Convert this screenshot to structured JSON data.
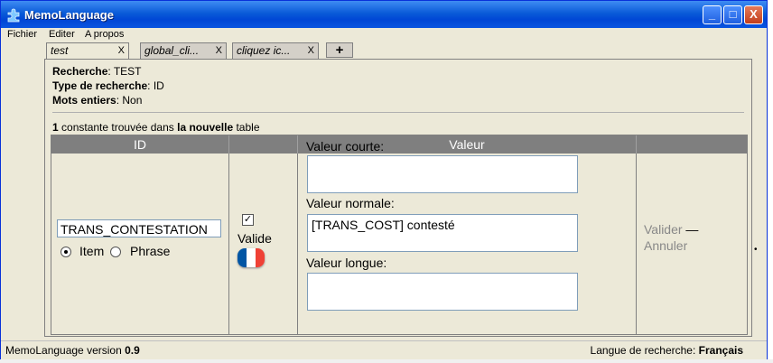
{
  "window": {
    "title": "MemoLanguage",
    "minimize": "_",
    "maximize": "□",
    "close": "X"
  },
  "menu": [
    "Fichier",
    "Editer",
    "A propos"
  ],
  "tabs": [
    {
      "label": "test",
      "close": "X"
    },
    {
      "label": "global_cli...",
      "close": "X"
    },
    {
      "label": "cliquez ic...",
      "close": "X"
    }
  ],
  "add_tab": "+",
  "search_info": {
    "recherche_label": "Recherche",
    "recherche_value": ": TEST",
    "type_label": "Type de recherche",
    "type_value": ": ID",
    "mots_label": "Mots entiers",
    "mots_value": ": Non"
  },
  "result": {
    "count": "1",
    "text_a": " constante trouvée dans ",
    "bold": "la nouvelle",
    "text_b": " table"
  },
  "table": {
    "col_id": "ID",
    "col_valeur": "Valeur",
    "id_value": "TRANS_CONTESTATION",
    "radio_item": "Item",
    "radio_phrase": "Phrase",
    "checkbox_mark": "✓",
    "valide": "Valide",
    "valeur_courte_label": "Valeur courte:",
    "valeur_courte": "",
    "valeur_normale_label": "Valeur normale:",
    "valeur_normale": "[TRANS_COST] contesté",
    "valeur_longue_label": "Valeur longue:",
    "valeur_longue": "",
    "valider": "Valider",
    "dash": " —",
    "annuler": "Annuler"
  },
  "status": {
    "version_label": "MemoLanguage version ",
    "version": "0.9",
    "langue_label": "Langue de recherche: ",
    "langue": "Français"
  },
  "colors": {
    "titlebar": "#0a5bd8",
    "header": "#7f7f7f",
    "flag_blue": "#0055a4",
    "flag_white": "#ffffff",
    "flag_red": "#ef4135"
  }
}
